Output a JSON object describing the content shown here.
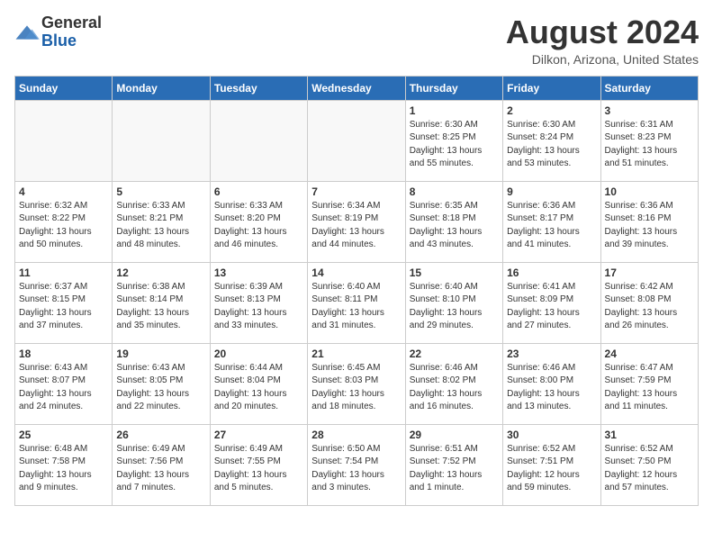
{
  "logo": {
    "general": "General",
    "blue": "Blue"
  },
  "header": {
    "month_year": "August 2024",
    "location": "Dilkon, Arizona, United States"
  },
  "weekdays": [
    "Sunday",
    "Monday",
    "Tuesday",
    "Wednesday",
    "Thursday",
    "Friday",
    "Saturday"
  ],
  "weeks": [
    [
      {
        "day": "",
        "info": ""
      },
      {
        "day": "",
        "info": ""
      },
      {
        "day": "",
        "info": ""
      },
      {
        "day": "",
        "info": ""
      },
      {
        "day": "1",
        "info": "Sunrise: 6:30 AM\nSunset: 8:25 PM\nDaylight: 13 hours\nand 55 minutes."
      },
      {
        "day": "2",
        "info": "Sunrise: 6:30 AM\nSunset: 8:24 PM\nDaylight: 13 hours\nand 53 minutes."
      },
      {
        "day": "3",
        "info": "Sunrise: 6:31 AM\nSunset: 8:23 PM\nDaylight: 13 hours\nand 51 minutes."
      }
    ],
    [
      {
        "day": "4",
        "info": "Sunrise: 6:32 AM\nSunset: 8:22 PM\nDaylight: 13 hours\nand 50 minutes."
      },
      {
        "day": "5",
        "info": "Sunrise: 6:33 AM\nSunset: 8:21 PM\nDaylight: 13 hours\nand 48 minutes."
      },
      {
        "day": "6",
        "info": "Sunrise: 6:33 AM\nSunset: 8:20 PM\nDaylight: 13 hours\nand 46 minutes."
      },
      {
        "day": "7",
        "info": "Sunrise: 6:34 AM\nSunset: 8:19 PM\nDaylight: 13 hours\nand 44 minutes."
      },
      {
        "day": "8",
        "info": "Sunrise: 6:35 AM\nSunset: 8:18 PM\nDaylight: 13 hours\nand 43 minutes."
      },
      {
        "day": "9",
        "info": "Sunrise: 6:36 AM\nSunset: 8:17 PM\nDaylight: 13 hours\nand 41 minutes."
      },
      {
        "day": "10",
        "info": "Sunrise: 6:36 AM\nSunset: 8:16 PM\nDaylight: 13 hours\nand 39 minutes."
      }
    ],
    [
      {
        "day": "11",
        "info": "Sunrise: 6:37 AM\nSunset: 8:15 PM\nDaylight: 13 hours\nand 37 minutes."
      },
      {
        "day": "12",
        "info": "Sunrise: 6:38 AM\nSunset: 8:14 PM\nDaylight: 13 hours\nand 35 minutes."
      },
      {
        "day": "13",
        "info": "Sunrise: 6:39 AM\nSunset: 8:13 PM\nDaylight: 13 hours\nand 33 minutes."
      },
      {
        "day": "14",
        "info": "Sunrise: 6:40 AM\nSunset: 8:11 PM\nDaylight: 13 hours\nand 31 minutes."
      },
      {
        "day": "15",
        "info": "Sunrise: 6:40 AM\nSunset: 8:10 PM\nDaylight: 13 hours\nand 29 minutes."
      },
      {
        "day": "16",
        "info": "Sunrise: 6:41 AM\nSunset: 8:09 PM\nDaylight: 13 hours\nand 27 minutes."
      },
      {
        "day": "17",
        "info": "Sunrise: 6:42 AM\nSunset: 8:08 PM\nDaylight: 13 hours\nand 26 minutes."
      }
    ],
    [
      {
        "day": "18",
        "info": "Sunrise: 6:43 AM\nSunset: 8:07 PM\nDaylight: 13 hours\nand 24 minutes."
      },
      {
        "day": "19",
        "info": "Sunrise: 6:43 AM\nSunset: 8:05 PM\nDaylight: 13 hours\nand 22 minutes."
      },
      {
        "day": "20",
        "info": "Sunrise: 6:44 AM\nSunset: 8:04 PM\nDaylight: 13 hours\nand 20 minutes."
      },
      {
        "day": "21",
        "info": "Sunrise: 6:45 AM\nSunset: 8:03 PM\nDaylight: 13 hours\nand 18 minutes."
      },
      {
        "day": "22",
        "info": "Sunrise: 6:46 AM\nSunset: 8:02 PM\nDaylight: 13 hours\nand 16 minutes."
      },
      {
        "day": "23",
        "info": "Sunrise: 6:46 AM\nSunset: 8:00 PM\nDaylight: 13 hours\nand 13 minutes."
      },
      {
        "day": "24",
        "info": "Sunrise: 6:47 AM\nSunset: 7:59 PM\nDaylight: 13 hours\nand 11 minutes."
      }
    ],
    [
      {
        "day": "25",
        "info": "Sunrise: 6:48 AM\nSunset: 7:58 PM\nDaylight: 13 hours\nand 9 minutes."
      },
      {
        "day": "26",
        "info": "Sunrise: 6:49 AM\nSunset: 7:56 PM\nDaylight: 13 hours\nand 7 minutes."
      },
      {
        "day": "27",
        "info": "Sunrise: 6:49 AM\nSunset: 7:55 PM\nDaylight: 13 hours\nand 5 minutes."
      },
      {
        "day": "28",
        "info": "Sunrise: 6:50 AM\nSunset: 7:54 PM\nDaylight: 13 hours\nand 3 minutes."
      },
      {
        "day": "29",
        "info": "Sunrise: 6:51 AM\nSunset: 7:52 PM\nDaylight: 13 hours\nand 1 minute."
      },
      {
        "day": "30",
        "info": "Sunrise: 6:52 AM\nSunset: 7:51 PM\nDaylight: 12 hours\nand 59 minutes."
      },
      {
        "day": "31",
        "info": "Sunrise: 6:52 AM\nSunset: 7:50 PM\nDaylight: 12 hours\nand 57 minutes."
      }
    ]
  ]
}
